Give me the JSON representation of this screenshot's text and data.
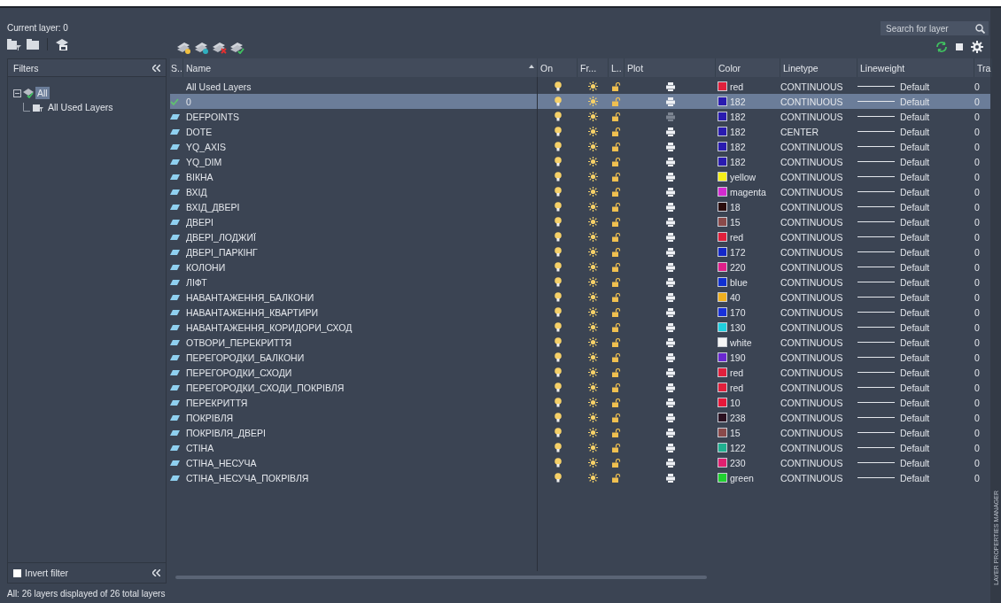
{
  "panel": {
    "current_layer": "Current layer: 0",
    "search": {
      "placeholder": "Search for layer"
    }
  },
  "filters": {
    "title": "Filters",
    "tree": [
      {
        "label": "All",
        "selected": true,
        "expanded": true,
        "children": [
          {
            "label": "All Used Layers",
            "selected": false
          }
        ]
      }
    ],
    "invert_filter": {
      "label": "Invert filter",
      "checked": false
    }
  },
  "table": {
    "columns": [
      "S..",
      "Name",
      "On",
      "Fr...",
      "L..",
      "Plot",
      "Color",
      "Linetype",
      "Lineweight",
      "Tra"
    ],
    "rows": [
      {
        "name": "All Used Layers",
        "kind": "filter",
        "selected": false,
        "on": true,
        "frozen": false,
        "locked": false,
        "plot": true,
        "color": "#e0203c",
        "color_name": "red",
        "linetype": "CONTINUOUS",
        "lineweight": "Default",
        "transparency": "0"
      },
      {
        "name": "0",
        "kind": "current",
        "selected": true,
        "on": true,
        "frozen": false,
        "locked": false,
        "plot": true,
        "color": "#2a1bb0",
        "color_name": "182",
        "linetype": "CONTINUOUS",
        "lineweight": "Default",
        "transparency": "0"
      },
      {
        "name": "DEFPOINTS",
        "kind": "layer",
        "selected": false,
        "on": true,
        "frozen": false,
        "locked": false,
        "plot": false,
        "color": "#2a1bb0",
        "color_name": "182",
        "linetype": "CONTINUOUS",
        "lineweight": "Default",
        "transparency": "0"
      },
      {
        "name": "DOTE",
        "kind": "layer",
        "selected": false,
        "on": true,
        "frozen": false,
        "locked": false,
        "plot": true,
        "color": "#2a1bb0",
        "color_name": "182",
        "linetype": "CENTER",
        "lineweight": "Default",
        "transparency": "0"
      },
      {
        "name": "YQ_AXIS",
        "kind": "layer",
        "selected": false,
        "on": true,
        "frozen": false,
        "locked": false,
        "plot": true,
        "color": "#2a1bb0",
        "color_name": "182",
        "linetype": "CONTINUOUS",
        "lineweight": "Default",
        "transparency": "0"
      },
      {
        "name": "YQ_DIM",
        "kind": "layer",
        "selected": false,
        "on": true,
        "frozen": false,
        "locked": false,
        "plot": true,
        "color": "#2a1bb0",
        "color_name": "182",
        "linetype": "CONTINUOUS",
        "lineweight": "Default",
        "transparency": "0"
      },
      {
        "name": "ВІКНА",
        "kind": "layer",
        "selected": false,
        "on": true,
        "frozen": false,
        "locked": false,
        "plot": true,
        "color": "#f5ef1a",
        "color_name": "yellow",
        "linetype": "CONTINUOUS",
        "lineweight": "Default",
        "transparency": "0"
      },
      {
        "name": "ВХІД",
        "kind": "layer",
        "selected": false,
        "on": true,
        "frozen": false,
        "locked": false,
        "plot": true,
        "color": "#d42ad0",
        "color_name": "magenta",
        "linetype": "CONTINUOUS",
        "lineweight": "Default",
        "transparency": "0"
      },
      {
        "name": "ВХІД_ДВЕРІ",
        "kind": "layer",
        "selected": false,
        "on": true,
        "frozen": false,
        "locked": false,
        "plot": true,
        "color": "#2a0c0c",
        "color_name": "18",
        "linetype": "CONTINUOUS",
        "lineweight": "Default",
        "transparency": "0"
      },
      {
        "name": "ДВЕРІ",
        "kind": "layer",
        "selected": false,
        "on": true,
        "frozen": false,
        "locked": false,
        "plot": true,
        "color": "#8a4a4a",
        "color_name": "15",
        "linetype": "CONTINUOUS",
        "lineweight": "Default",
        "transparency": "0"
      },
      {
        "name": "ДВЕРІ_ЛОДЖИЇ",
        "kind": "layer",
        "selected": false,
        "on": true,
        "frozen": false,
        "locked": false,
        "plot": true,
        "color": "#e0203c",
        "color_name": "red",
        "linetype": "CONTINUOUS",
        "lineweight": "Default",
        "transparency": "0"
      },
      {
        "name": "ДВЕРІ_ПАРКІНГ",
        "kind": "layer",
        "selected": false,
        "on": true,
        "frozen": false,
        "locked": false,
        "plot": true,
        "color": "#1428c8",
        "color_name": "172",
        "linetype": "CONTINUOUS",
        "lineweight": "Default",
        "transparency": "0"
      },
      {
        "name": "КОЛОНИ",
        "kind": "layer",
        "selected": false,
        "on": true,
        "frozen": false,
        "locked": false,
        "plot": true,
        "color": "#e0208a",
        "color_name": "220",
        "linetype": "CONTINUOUS",
        "lineweight": "Default",
        "transparency": "0"
      },
      {
        "name": "ЛІФТ",
        "kind": "layer",
        "selected": false,
        "on": true,
        "frozen": false,
        "locked": false,
        "plot": true,
        "color": "#1030d0",
        "color_name": "blue",
        "linetype": "CONTINUOUS",
        "lineweight": "Default",
        "transparency": "0"
      },
      {
        "name": "НАВАНТАЖЕННЯ_БАЛКОНИ",
        "kind": "layer",
        "selected": false,
        "on": true,
        "frozen": false,
        "locked": false,
        "plot": true,
        "color": "#f0b020",
        "color_name": "40",
        "linetype": "CONTINUOUS",
        "lineweight": "Default",
        "transparency": "0"
      },
      {
        "name": "НАВАНТАЖЕННЯ_КВАРТИРИ",
        "kind": "layer",
        "selected": false,
        "on": true,
        "frozen": false,
        "locked": false,
        "plot": true,
        "color": "#1830d8",
        "color_name": "170",
        "linetype": "CONTINUOUS",
        "lineweight": "Default",
        "transparency": "0"
      },
      {
        "name": "НАВАНТАЖЕННЯ_КОРИДОРИ_СХОД",
        "kind": "layer",
        "selected": false,
        "on": true,
        "frozen": false,
        "locked": false,
        "plot": true,
        "color": "#20d0e0",
        "color_name": "130",
        "linetype": "CONTINUOUS",
        "lineweight": "Default",
        "transparency": "0"
      },
      {
        "name": "ОТВОРИ_ПЕРЕКРИТТЯ",
        "kind": "layer",
        "selected": false,
        "on": true,
        "frozen": false,
        "locked": false,
        "plot": true,
        "color": "#f4f4f4",
        "color_name": "white",
        "linetype": "CONTINUOUS",
        "lineweight": "Default",
        "transparency": "0"
      },
      {
        "name": "ПЕРЕГОРОДКИ_БАЛКОНИ",
        "kind": "layer",
        "selected": false,
        "on": true,
        "frozen": false,
        "locked": false,
        "plot": true,
        "color": "#6a28d0",
        "color_name": "190",
        "linetype": "CONTINUOUS",
        "lineweight": "Default",
        "transparency": "0"
      },
      {
        "name": "ПЕРЕГОРОДКИ_СХОДИ",
        "kind": "layer",
        "selected": false,
        "on": true,
        "frozen": false,
        "locked": false,
        "plot": true,
        "color": "#e0203c",
        "color_name": "red",
        "linetype": "CONTINUOUS",
        "lineweight": "Default",
        "transparency": "0"
      },
      {
        "name": "ПЕРЕГОРОДКИ_СХОДИ_ПОКРІВЛЯ",
        "kind": "layer",
        "selected": false,
        "on": true,
        "frozen": false,
        "locked": false,
        "plot": true,
        "color": "#e0203c",
        "color_name": "red",
        "linetype": "CONTINUOUS",
        "lineweight": "Default",
        "transparency": "0"
      },
      {
        "name": "ПЕРЕКРИТТЯ",
        "kind": "layer",
        "selected": false,
        "on": true,
        "frozen": false,
        "locked": false,
        "plot": true,
        "color": "#e8183a",
        "color_name": "10",
        "linetype": "CONTINUOUS",
        "lineweight": "Default",
        "transparency": "0"
      },
      {
        "name": "ПОКРІВЛЯ",
        "kind": "layer",
        "selected": false,
        "on": true,
        "frozen": false,
        "locked": false,
        "plot": true,
        "color": "#2a1020",
        "color_name": "238",
        "linetype": "CONTINUOUS",
        "lineweight": "Default",
        "transparency": "0"
      },
      {
        "name": "ПОКРІВЛЯ_ДВЕРІ",
        "kind": "layer",
        "selected": false,
        "on": true,
        "frozen": false,
        "locked": false,
        "plot": true,
        "color": "#8a4a4b",
        "color_name": "15",
        "linetype": "CONTINUOUS",
        "lineweight": "Default",
        "transparency": "0"
      },
      {
        "name": "СТІНА",
        "kind": "layer",
        "selected": false,
        "on": true,
        "frozen": false,
        "locked": false,
        "plot": true,
        "color": "#20b090",
        "color_name": "122",
        "linetype": "CONTINUOUS",
        "lineweight": "Default",
        "transparency": "0"
      },
      {
        "name": "СТІНА_НЕСУЧА",
        "kind": "layer",
        "selected": false,
        "on": true,
        "frozen": false,
        "locked": false,
        "plot": true,
        "color": "#e02070",
        "color_name": "230",
        "linetype": "CONTINUOUS",
        "lineweight": "Default",
        "transparency": "0"
      },
      {
        "name": "СТІНА_НЕСУЧА_ПОКРІВЛЯ",
        "kind": "layer",
        "selected": false,
        "on": true,
        "frozen": false,
        "locked": false,
        "plot": true,
        "color": "#20d030",
        "color_name": "green",
        "linetype": "CONTINUOUS",
        "lineweight": "Default",
        "transparency": "0"
      }
    ]
  },
  "status_bar": "All: 26 layers displayed of 26 total layers",
  "side_tab": "LAYER PROPERTIES MANAGER"
}
